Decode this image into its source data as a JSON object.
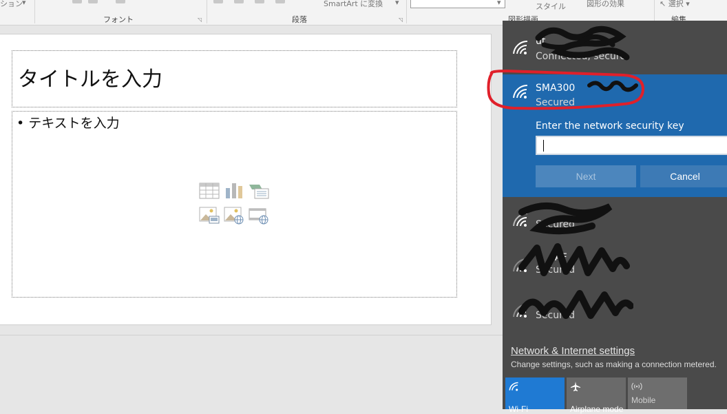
{
  "ribbon": {
    "clip_left": "ション",
    "font_group": "フォント",
    "paragraph_group": "段落",
    "smartart": "SmartArt に変換",
    "style": "スタイル",
    "shape_effects": "図形の効果",
    "select": "選択",
    "drawing_group": "図形描画",
    "editing_group": "編集"
  },
  "slide": {
    "title_placeholder": "タイトルを入力",
    "body_placeholder": "テキストを入力",
    "insert_icons": [
      "table-icon",
      "chart-icon",
      "smartart-icon",
      "picture-icon",
      "online-picture-icon",
      "video-icon"
    ]
  },
  "network": {
    "connected": {
      "ssid": "ut",
      "status": "Connected, secure"
    },
    "selected": {
      "ssid": "SMA300",
      "status": "Secured",
      "key_label": "Enter the network security key",
      "key_value": "",
      "next_label": "Next",
      "cancel_label": "Cancel"
    },
    "others": [
      {
        "ssid": "",
        "status": "Secured"
      },
      {
        "ssid": "AF",
        "status": "Secured"
      },
      {
        "ssid": "",
        "status": "Secured"
      }
    ],
    "settings_link": "Network & Internet settings",
    "settings_desc": "Change settings, such as making a connection metered.",
    "tiles": [
      {
        "label": "Wi-Fi",
        "active": true,
        "icon": "wifi-icon"
      },
      {
        "label": "Airplane mode",
        "active": false,
        "icon": "airplane-icon"
      },
      {
        "label": "Mobile",
        "active": false,
        "icon": "mobile-hotspot-icon"
      }
    ]
  },
  "colors": {
    "flyout_bg": "#4a4a4a",
    "selected_bg": "#1f69ae",
    "annotation": "#e0202a"
  }
}
